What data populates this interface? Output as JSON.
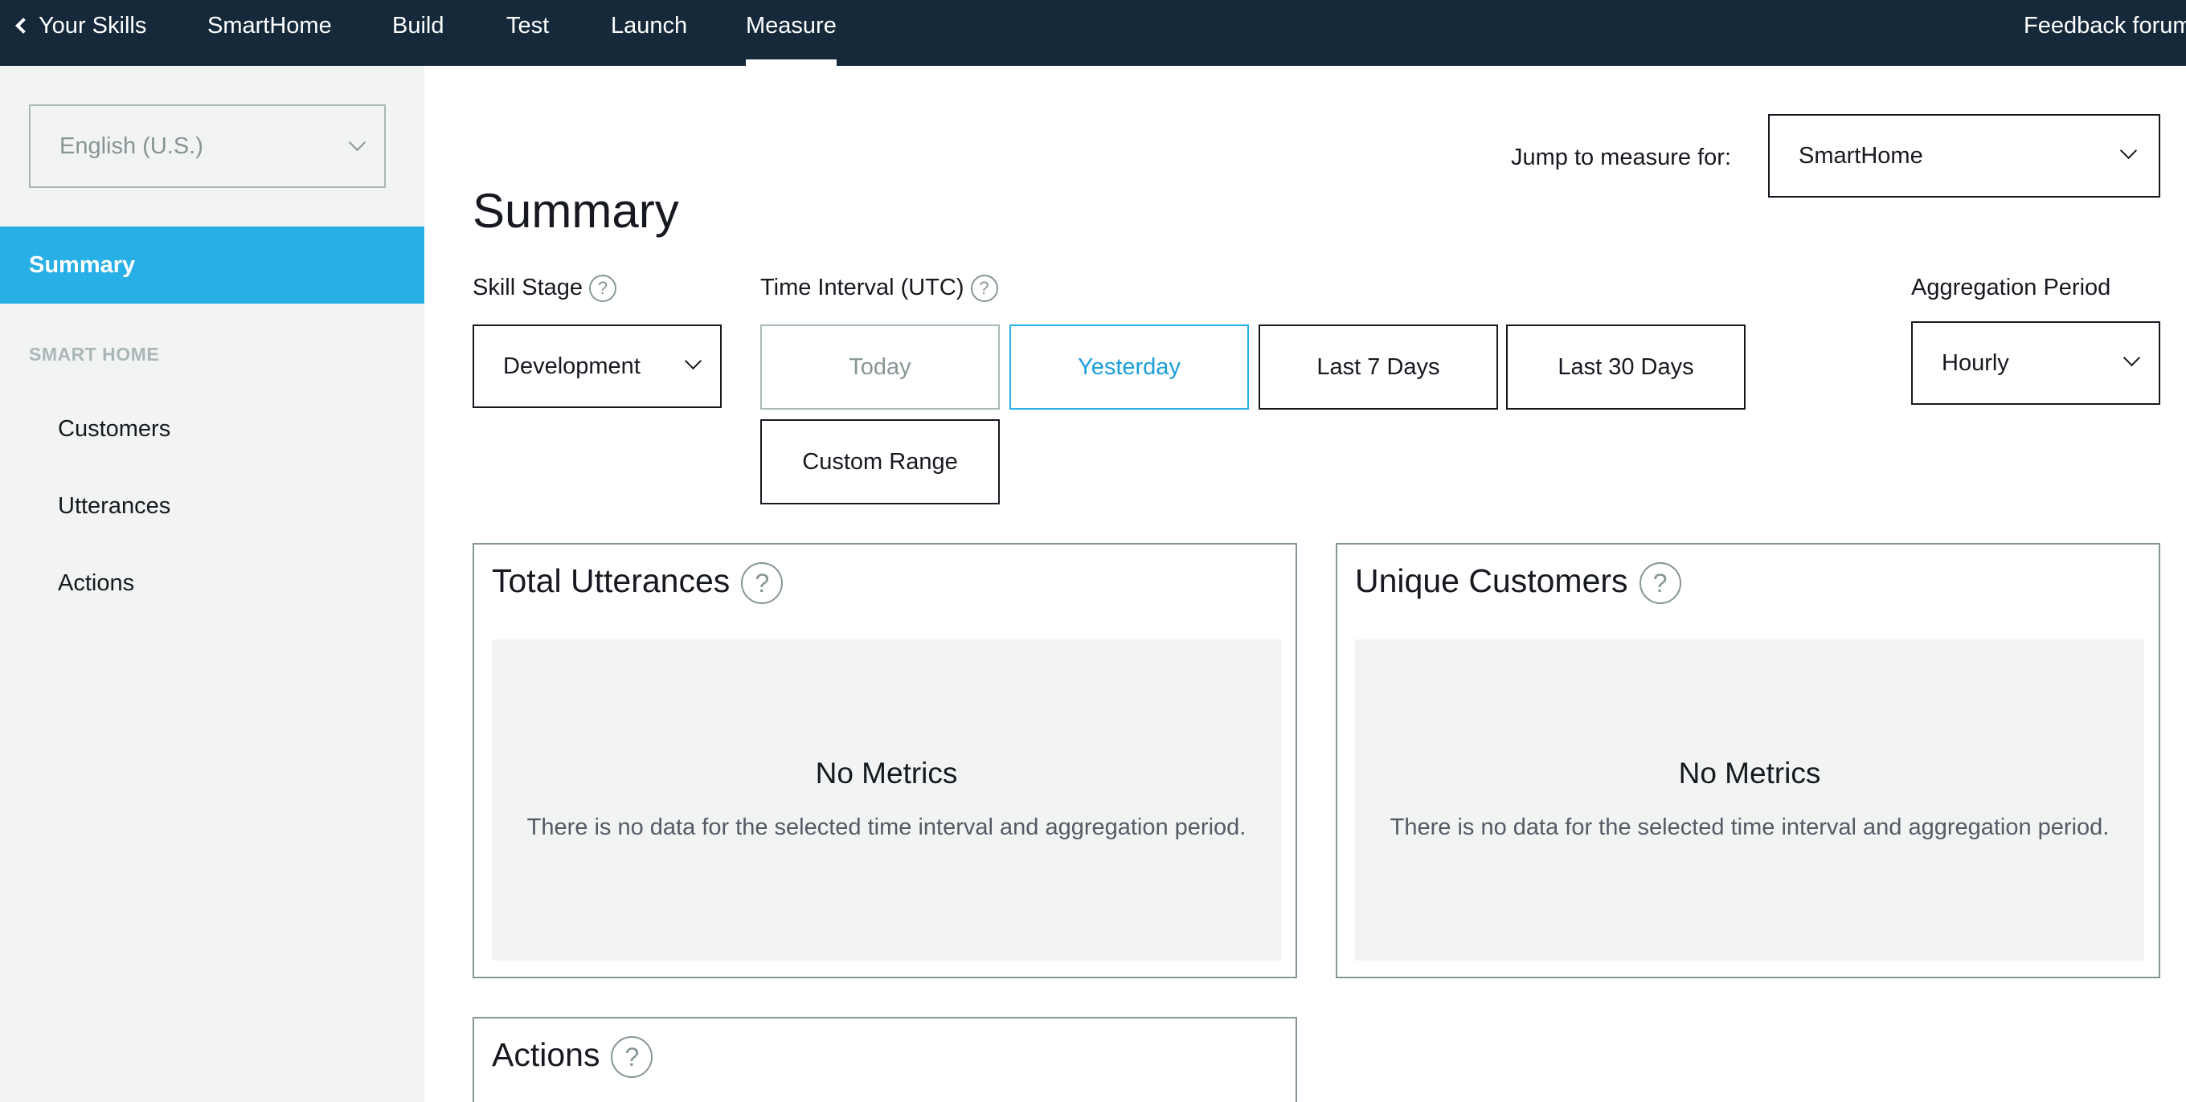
{
  "topnav": {
    "back_label": "Your Skills",
    "items": [
      "SmartHome",
      "Build",
      "Test",
      "Launch",
      "Measure"
    ],
    "active": "Measure",
    "feedback": "Feedback forum"
  },
  "sidebar": {
    "locale": "English (U.S.)",
    "active_item": "Summary",
    "section_title": "SMART HOME",
    "items": [
      "Customers",
      "Utterances",
      "Actions"
    ]
  },
  "main": {
    "jump_label": "Jump to measure for:",
    "jump_value": "SmartHome",
    "title": "Summary",
    "skill_stage_label": "Skill Stage",
    "skill_stage_value": "Development",
    "time_interval_label": "Time Interval (UTC)",
    "time_options": [
      "Today",
      "Yesterday",
      "Last 7 Days",
      "Last 30 Days",
      "Custom Range"
    ],
    "time_selected": "Yesterday",
    "aggregation_label": "Aggregation Period",
    "aggregation_value": "Hourly",
    "help_glyph": "?",
    "cards": [
      {
        "title": "Total Utterances",
        "empty_title": "No Metrics",
        "empty_text": "There is no data for the selected time interval and aggregation period."
      },
      {
        "title": "Unique Customers",
        "empty_title": "No Metrics",
        "empty_text": "There is no data for the selected time interval and aggregation period."
      },
      {
        "title": "Actions"
      }
    ]
  },
  "colors": {
    "nav_bg": "#15293a",
    "sidebar_bg": "#f2f3f3",
    "accent": "#28b0e6",
    "text": "#16191f",
    "muted": "#879596"
  }
}
